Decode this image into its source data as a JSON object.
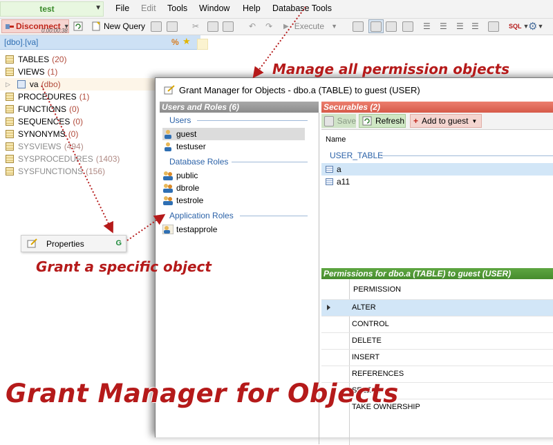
{
  "connection": {
    "name": "test"
  },
  "menu": [
    {
      "label": "File"
    },
    {
      "label": "Edit"
    },
    {
      "label": "Tools"
    },
    {
      "label": "Window"
    },
    {
      "label": "Help"
    },
    {
      "label": "Database Tools"
    }
  ],
  "toolbar": {
    "disconnect_label": "Disconnect",
    "timer": "0.00:00:38",
    "new_query_label": "New Query",
    "execute_label": "Execute",
    "sql_label": "SQL"
  },
  "tree": {
    "header": "[dbo].[va]",
    "header_pct": "%",
    "items": [
      {
        "label": "TABLES",
        "count": "(20)"
      },
      {
        "label": "VIEWS",
        "count": "(1)"
      },
      {
        "label": "va",
        "count": "(dbo)"
      },
      {
        "label": "PROCEDURES",
        "count": "(1)"
      },
      {
        "label": "FUNCTIONS",
        "count": "(0)"
      },
      {
        "label": "SEQUENCES",
        "count": "(0)"
      },
      {
        "label": "SYNONYMS",
        "count": "(0)"
      },
      {
        "label": "SYSVIEWS",
        "count": "(494)"
      },
      {
        "label": "SYSPROCEDURES",
        "count": "(1403)"
      },
      {
        "label": "SYSFUNCTIONS",
        "count": "(156)"
      }
    ]
  },
  "context_menu": {
    "properties_label": "Properties",
    "shortcut": "G"
  },
  "annotations": {
    "manage": "Manage all permission objects",
    "grant": "Grant a specific object",
    "title": "Grant Manager for Objects"
  },
  "grant_manager": {
    "title": "Grant Manager for Objects - dbo.a (TABLE) to guest (USER)",
    "users_roles_header": "Users and Roles (6)",
    "groups": {
      "users": "Users",
      "database_roles": "Database Roles",
      "application_roles": "Application Roles"
    },
    "users": [
      "guest",
      "testuser"
    ],
    "database_roles": [
      "public",
      "dbrole",
      "testrole"
    ],
    "application_roles": [
      "testapprole"
    ],
    "securables_header": "Securables (2)",
    "buttons": {
      "save": "Save",
      "refresh": "Refresh",
      "add": "Add to guest"
    },
    "securables_column": "Name",
    "securables_group": "USER_TABLE",
    "securables": [
      "a",
      "a11"
    ],
    "permissions_header": "Permissions for dbo.a (TABLE) to guest (USER)",
    "permissions_column": "PERMISSION",
    "permissions": [
      "ALTER",
      "CONTROL",
      "DELETE",
      "INSERT",
      "REFERENCES",
      "SELECT",
      "TAKE OWNERSHIP"
    ]
  },
  "colors": {
    "accent_red": "#b51a1a",
    "securables_header": "#d65a49",
    "permissions_header": "#468c2d",
    "users_header": "#8c8c8c",
    "selection": "#d2e6f7"
  }
}
